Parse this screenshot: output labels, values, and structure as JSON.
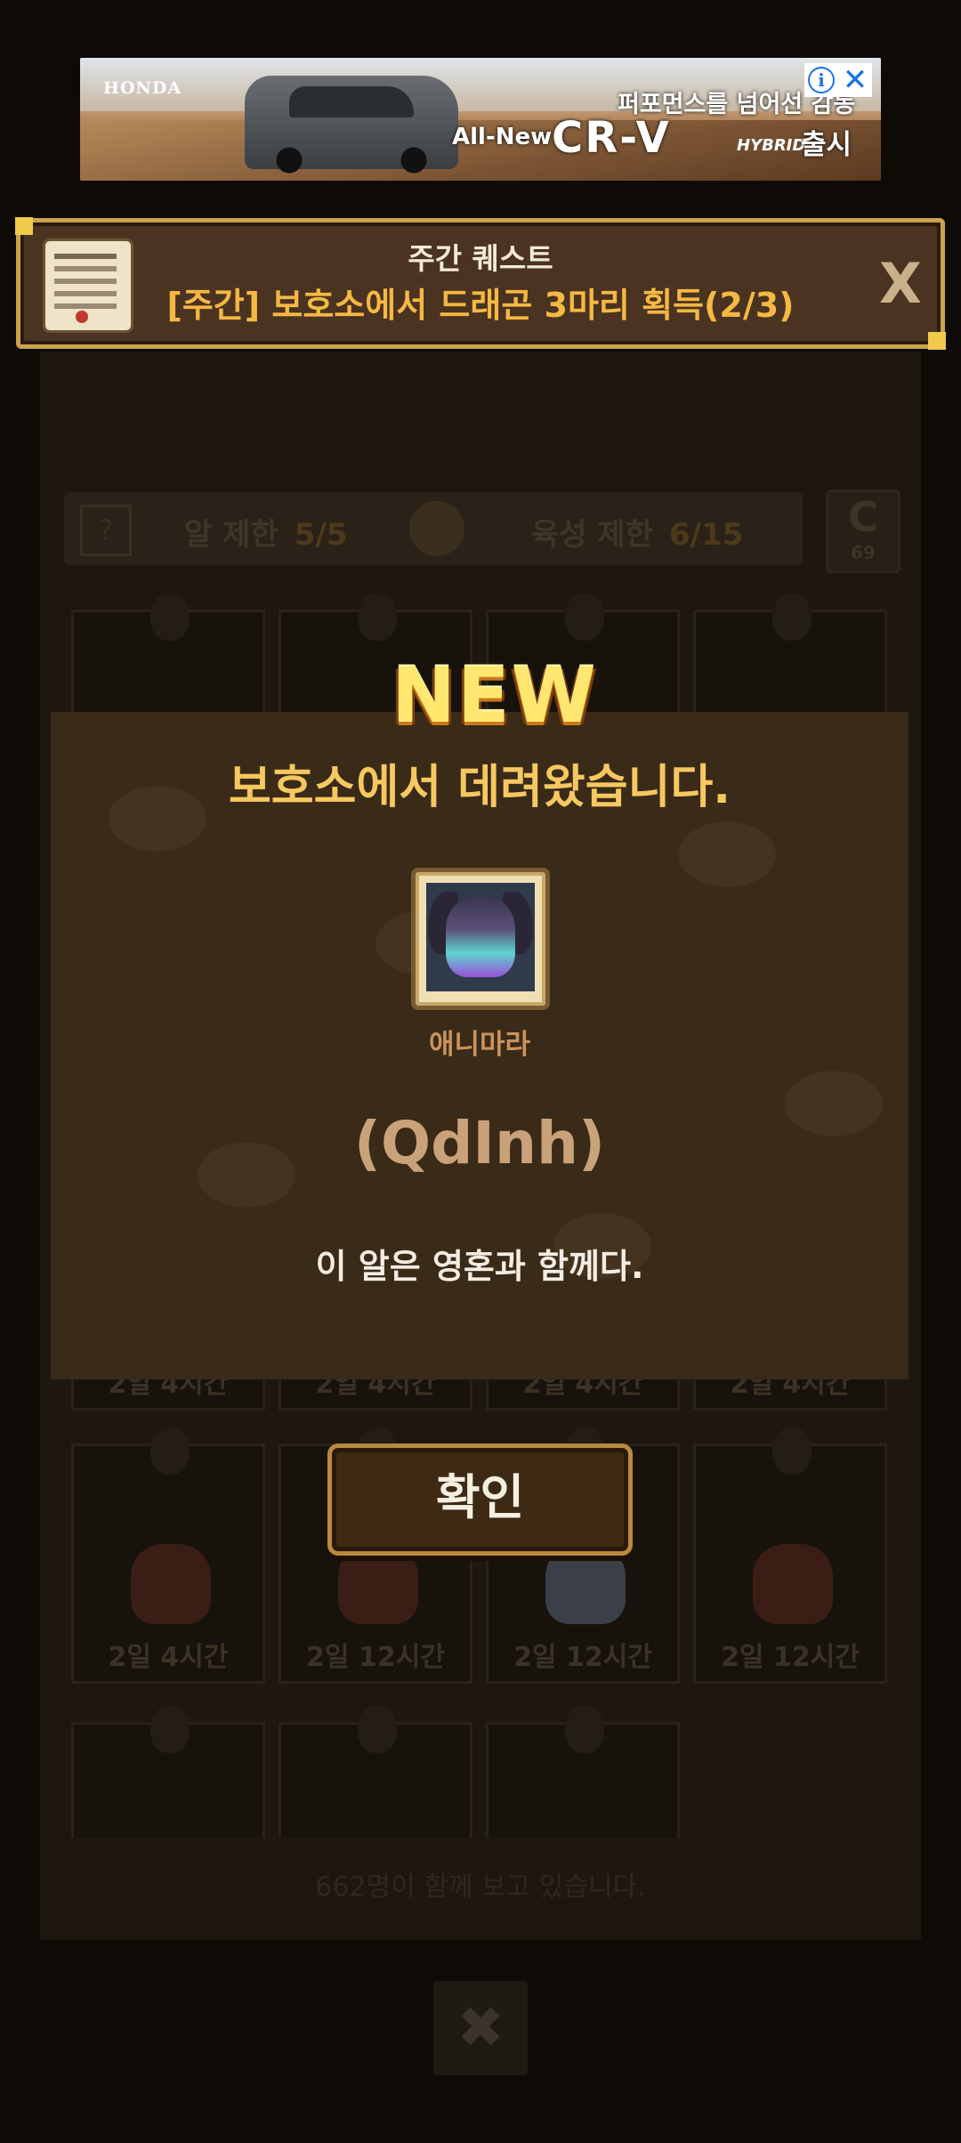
{
  "ad": {
    "brand": "HONDA",
    "tagline": "퍼포먼스를 넘어선 감동",
    "all_new": "All-New",
    "model": "CR-V",
    "hybrid": "HYBRID",
    "launch": "출시",
    "info_glyph": "i",
    "close_glyph": "✕"
  },
  "quest": {
    "title": "주간 퀘스트",
    "description": "[주간] 보호소에서 드래곤 3마리 획득(2/3)",
    "close_label": "X"
  },
  "background": {
    "stat_help": "?",
    "egg_limit_label": "알 제한",
    "egg_limit_value": "5/5",
    "raise_limit_label": "육성 제한",
    "raise_limit_value": "6/15",
    "refresh_count": "69",
    "refresh_glyph": "C",
    "row1_timers": [
      "2일 4시간",
      "2일 4시간",
      "2일 4시간",
      "2일 4시간"
    ],
    "row2_timers": [
      "2일 4시간",
      "2일 12시간",
      "2일 12시간",
      "2일 12시간"
    ],
    "viewers": "662명이 함께 보고 있습니다.",
    "close_glyph": "✖"
  },
  "modal": {
    "badge": "NEW",
    "title": "보호소에서 데려왔습니다.",
    "dragon_name": "애니마라",
    "egg_code": "(QdInh)",
    "egg_description": "이 알은 영혼과 함께다.",
    "confirm_label": "확인"
  },
  "colors": {
    "accent_gold": "#f7c860",
    "quest_orange": "#f5b843",
    "new_yellow": "#ffe770",
    "modal_bg": "#3a2a18"
  }
}
